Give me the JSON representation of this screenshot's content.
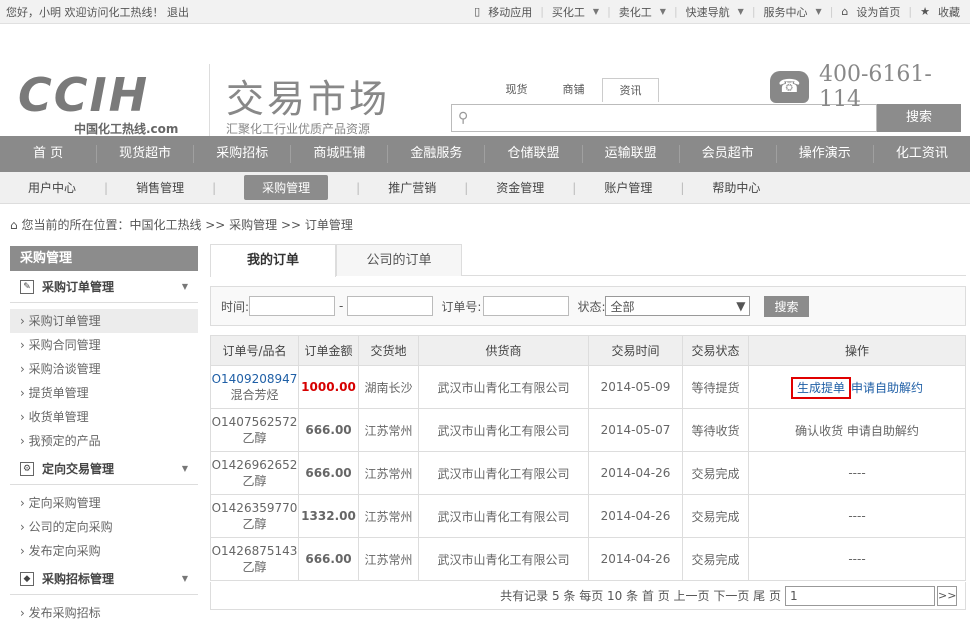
{
  "topbar": {
    "greeting": "您好，小明 欢迎访问化工热线！",
    "logout": "退出",
    "mobile": "移动应用",
    "buy": "买化工",
    "sell": "卖化工",
    "quicknav": "快速导航",
    "service": "服务中心",
    "home": "设为首页",
    "fav": "收藏"
  },
  "header": {
    "logo": "CCIH",
    "logo_sub": "中国化工热线.com",
    "market_title": "交易市场",
    "market_sub": "汇聚化工行业优质产品资源",
    "tabs": [
      "现货",
      "商铺",
      "资讯"
    ],
    "search_btn": "搜索",
    "phone": "400-6161-114"
  },
  "nav": [
    "首 页",
    "现货超市",
    "采购招标",
    "商城旺铺",
    "金融服务",
    "仓储联盟",
    "运输联盟",
    "会员超市",
    "操作演示",
    "化工资讯"
  ],
  "subnav": [
    "用户中心",
    "销售管理",
    "采购管理",
    "推广营销",
    "资金管理",
    "账户管理",
    "帮助中心"
  ],
  "breadcrumb": "您当前的所在位置：中国化工热线 >> 采购管理 >> 订单管理",
  "sidebar": {
    "title": "采购管理",
    "g1": "采购订单管理",
    "g1_items": [
      "采购订单管理",
      "采购合同管理",
      "采购洽谈管理",
      "提货单管理",
      "收货单管理",
      "我预定的产品"
    ],
    "g2": "定向交易管理",
    "g2_items": [
      "定向采购管理",
      "公司的定向采购",
      "发布定向采购"
    ],
    "g3": "采购招标管理",
    "g3_items": [
      "发布采购招标"
    ]
  },
  "tabs": [
    "我的订单",
    "公司的订单"
  ],
  "filter": {
    "time": "时间:",
    "dash": "-",
    "order_no": "订单号:",
    "status": "状态:",
    "status_val": "全部",
    "search": "搜索"
  },
  "table": {
    "headers": [
      "订单号/品名",
      "订单金额",
      "交货地",
      "供货商",
      "交易时间",
      "交易状态",
      "操作"
    ],
    "rows": [
      {
        "id": "O1409208947",
        "name": "混合芳烃",
        "amount": "1000.00",
        "place": "湖南长沙",
        "supplier": "武汉市山青化工有限公司",
        "date": "2014-05-09",
        "status": "等待提货",
        "op1": "生成提单",
        "op2": "申请自助解约"
      },
      {
        "id": "O1407562572",
        "name": "乙醇",
        "amount": "666.00",
        "place": "江苏常州",
        "supplier": "武汉市山青化工有限公司",
        "date": "2014-05-07",
        "status": "等待收货",
        "op1": "确认收货",
        "op2": "申请自助解约"
      },
      {
        "id": "O1426962652",
        "name": "乙醇",
        "amount": "666.00",
        "place": "江苏常州",
        "supplier": "武汉市山青化工有限公司",
        "date": "2014-04-26",
        "status": "交易完成",
        "op1": "----",
        "op2": ""
      },
      {
        "id": "O1426359770",
        "name": "乙醇",
        "amount": "1332.00",
        "place": "江苏常州",
        "supplier": "武汉市山青化工有限公司",
        "date": "2014-04-26",
        "status": "交易完成",
        "op1": "----",
        "op2": ""
      },
      {
        "id": "O1426875143",
        "name": "乙醇",
        "amount": "666.00",
        "place": "江苏常州",
        "supplier": "武汉市山青化工有限公司",
        "date": "2014-04-26",
        "status": "交易完成",
        "op1": "----",
        "op2": ""
      }
    ]
  },
  "pager": {
    "text": "共有记录 5 条 每页 10 条  首 页 上一页 下一页 尾 页",
    "page": "1",
    "go": ">>"
  }
}
